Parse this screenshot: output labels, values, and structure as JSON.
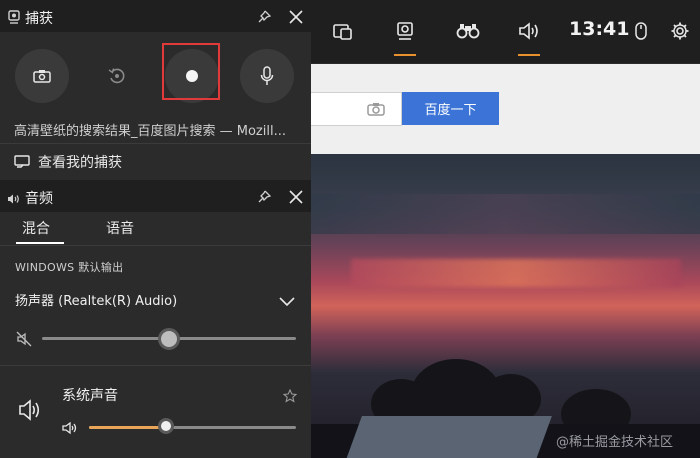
{
  "capture": {
    "title": "捕获",
    "description": "高清壁纸的搜索结果_百度图片搜索 — Mozill...",
    "see_my_captures": "查看我的捕获"
  },
  "audio": {
    "title": "音频",
    "tabs": [
      "混合",
      "语音"
    ],
    "section_label": "WINDOWS 默认输出",
    "device": "扬声器 (Realtek(R) Audio)",
    "master_volume": 0.5,
    "app_name": "系统声音",
    "app_volume": 0.37
  },
  "gamebar": {
    "time": "13:41"
  },
  "browser": {
    "search_button": "百度一下"
  },
  "watermark": "@稀土掘金技术社区",
  "colors": {
    "accent": "#e8912e",
    "record_highlight": "#e03a3a",
    "search_button": "#3b74d6"
  }
}
